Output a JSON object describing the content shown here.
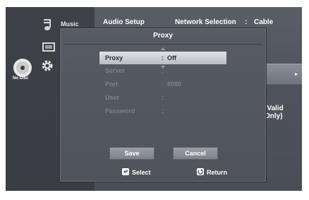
{
  "header": {
    "music_label": "Music",
    "audio_setup": "Audio Setup",
    "network_selection": "Network Selection",
    "network_colon": ":",
    "network_value": "Cable"
  },
  "sidebar": {
    "disc_label": "No Disc",
    "icons": [
      "music-icon",
      "photo-icon",
      "setup-gear-icon",
      "disc-icon"
    ]
  },
  "background": {
    "valid_only": "(Valid Only)"
  },
  "popup": {
    "title": "Proxy",
    "rows": [
      {
        "label": "Proxy",
        "colon": ":",
        "value": "Off"
      },
      {
        "label": "Server",
        "colon": ":",
        "value": ""
      },
      {
        "label": "Port",
        "colon": ":",
        "value": "8080"
      },
      {
        "label": "User",
        "colon": ":",
        "value": ""
      },
      {
        "label": "Password",
        "colon": ":",
        "value": ""
      }
    ],
    "save_label": "Save",
    "cancel_label": "Cancel",
    "select_hint": "Select",
    "return_hint": "Return"
  },
  "colors": {
    "selected_row": "#d0d3d8",
    "disabled_text": "#7c8088",
    "background": "#4e525a"
  }
}
